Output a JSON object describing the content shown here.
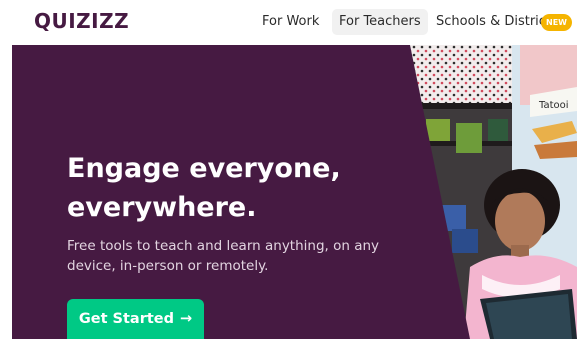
{
  "header": {
    "logo_text": "QUIZIZZ",
    "nav": [
      {
        "label": "For Work"
      },
      {
        "label": "For Teachers"
      },
      {
        "label": "Schools & Districts"
      }
    ],
    "new_badge": "NEW"
  },
  "hero": {
    "headline": "Engage everyone, everywhere.",
    "subtext": "Free tools to teach and learn anything, on any device, in-person or remotely.",
    "cta_label": "Get Started",
    "cta_icon": "arrow-right-icon",
    "photo_sign_text": "Tatooi"
  },
  "colors": {
    "brand_purple": "#461a42",
    "cta_green": "#00c985",
    "badge_yellow": "#f5b400"
  }
}
